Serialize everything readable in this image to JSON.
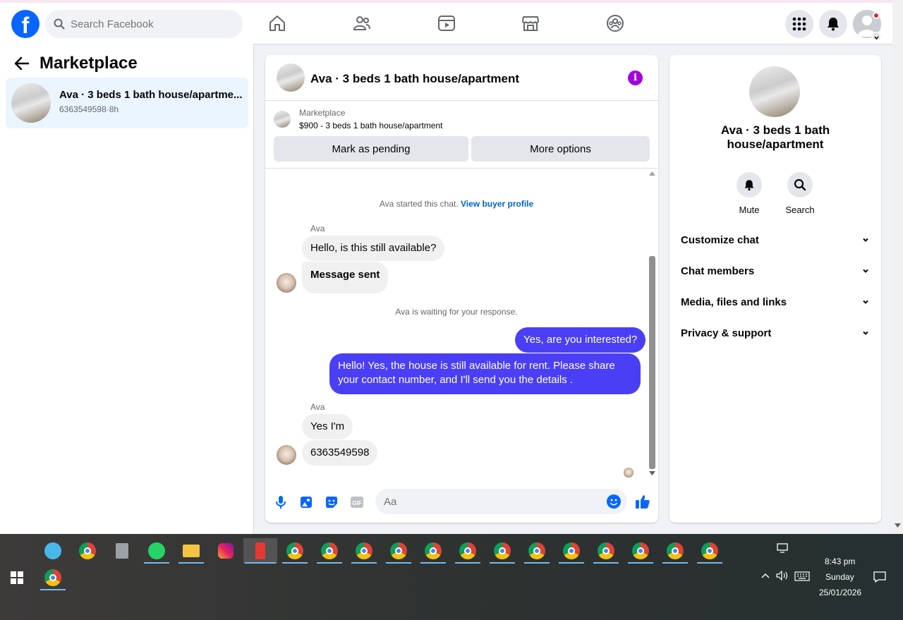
{
  "topbar": {
    "logo": "f",
    "search_placeholder": "Search Facebook",
    "nav_icons": [
      "home-icon",
      "friends-icon",
      "watch-icon",
      "marketplace-icon",
      "groups-icon"
    ],
    "right_icons": [
      "menu-grid-icon",
      "notifications-icon",
      "profile-avatar"
    ]
  },
  "left": {
    "title": "Marketplace",
    "conversation": {
      "title": "Ava · 3 beds 1 bath house/apartme...",
      "phone": "6363549598",
      "sep": "·",
      "time": "8h"
    }
  },
  "chat": {
    "title": "Ava · 3 beds 1 bath house/apartment",
    "listing_label": "Marketplace",
    "listing_price": "$900 - 3 beds 1 bath house/apartment",
    "mark_pending": "Mark as pending",
    "more_options": "More options",
    "started_text": "Ava started this chat.",
    "view_profile": "View buyer profile",
    "sender1": "Ava",
    "msg1": "Hello, is this still available?",
    "msg2": "Message sent",
    "waiting": "Ava is waiting for your response.",
    "out1": "Yes, are you interested?",
    "out2": "Hello! Yes, the house is still available for rent. Please share your contact number, and I'll send you the details .",
    "sender2": "Ava",
    "msg3": "Yes I'm",
    "msg4": "6363549598",
    "composer_placeholder": "Aa"
  },
  "right": {
    "title": "Ava · 3 beds 1 bath house/apartment",
    "mute": "Mute",
    "search": "Search",
    "sections": [
      "Customize chat",
      "Chat members",
      "Media, files and links",
      "Privacy & support"
    ]
  },
  "taskbar": {
    "time": "8:43 pm",
    "day": "Sunday",
    "date": "25/01/2026"
  }
}
